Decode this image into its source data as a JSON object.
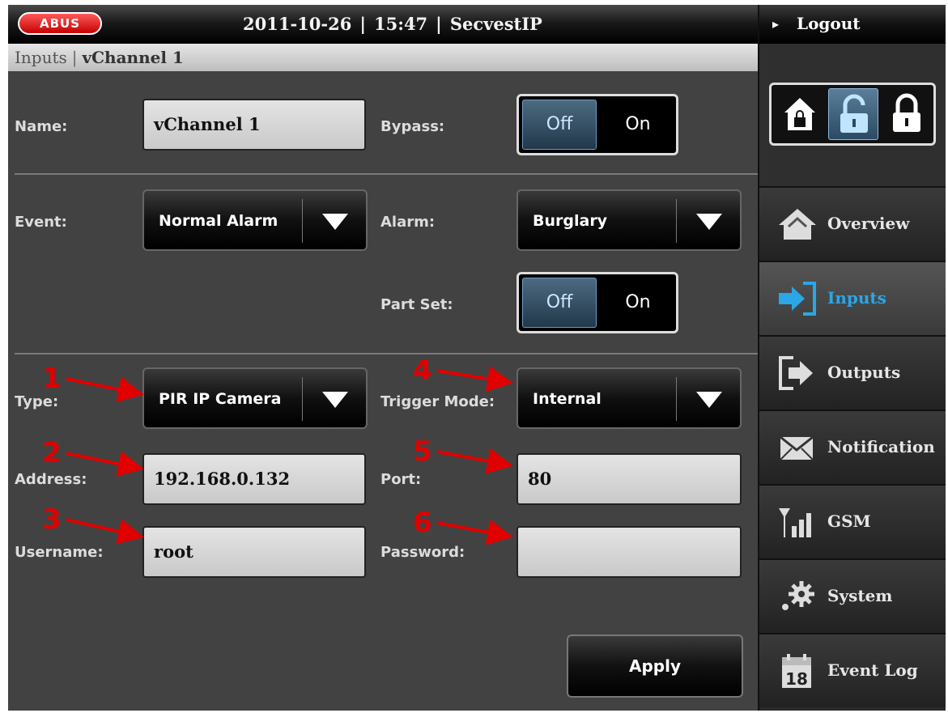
{
  "header": {
    "logo": "ABUS",
    "date": "2011-10-26",
    "time": "15:47",
    "product": "SecvestIP",
    "separator": "|",
    "logout_arrow": "▸",
    "logout_label": "Logout"
  },
  "breadcrumb": {
    "section": "Inputs",
    "separator": "|",
    "current": "vChannel 1"
  },
  "form": {
    "name_label": "Name:",
    "name_value": "vChannel 1",
    "bypass_label": "Bypass:",
    "bypass": {
      "off": "Off",
      "on": "On",
      "selected": "Off"
    },
    "event_label": "Event:",
    "event_value": "Normal Alarm",
    "alarm_label": "Alarm:",
    "alarm_value": "Burglary",
    "partset_label": "Part Set:",
    "partset": {
      "off": "Off",
      "on": "On",
      "selected": "Off"
    },
    "type_label": "Type:",
    "type_value": "PIR IP Camera",
    "trigger_label": "Trigger Mode:",
    "trigger_value": "Internal",
    "address_label": "Address:",
    "address_value": "192.168.0.132",
    "port_label": "Port:",
    "port_value": "80",
    "username_label": "Username:",
    "username_value": "root",
    "password_label": "Password:",
    "password_value": "",
    "apply_label": "Apply"
  },
  "annotations": [
    "1",
    "2",
    "3",
    "4",
    "5",
    "6"
  ],
  "sidebar": {
    "arm_states": [
      "unset",
      "part-set",
      "full-set"
    ],
    "active_state": "part-set",
    "items": [
      {
        "label": "Overview",
        "icon": "house-icon"
      },
      {
        "label": "Inputs",
        "icon": "inputs-icon"
      },
      {
        "label": "Outputs",
        "icon": "outputs-icon"
      },
      {
        "label": "Notification",
        "icon": "envelope-icon"
      },
      {
        "label": "GSM",
        "icon": "signal-icon"
      },
      {
        "label": "System",
        "icon": "gear-icon"
      },
      {
        "label": "Event Log",
        "icon": "calendar-icon",
        "icon_text": "18"
      }
    ],
    "active_item": "Inputs"
  },
  "colors": {
    "accent": "#2aa7e6",
    "annotation": "#e00000",
    "logo_red": "#d40000"
  }
}
